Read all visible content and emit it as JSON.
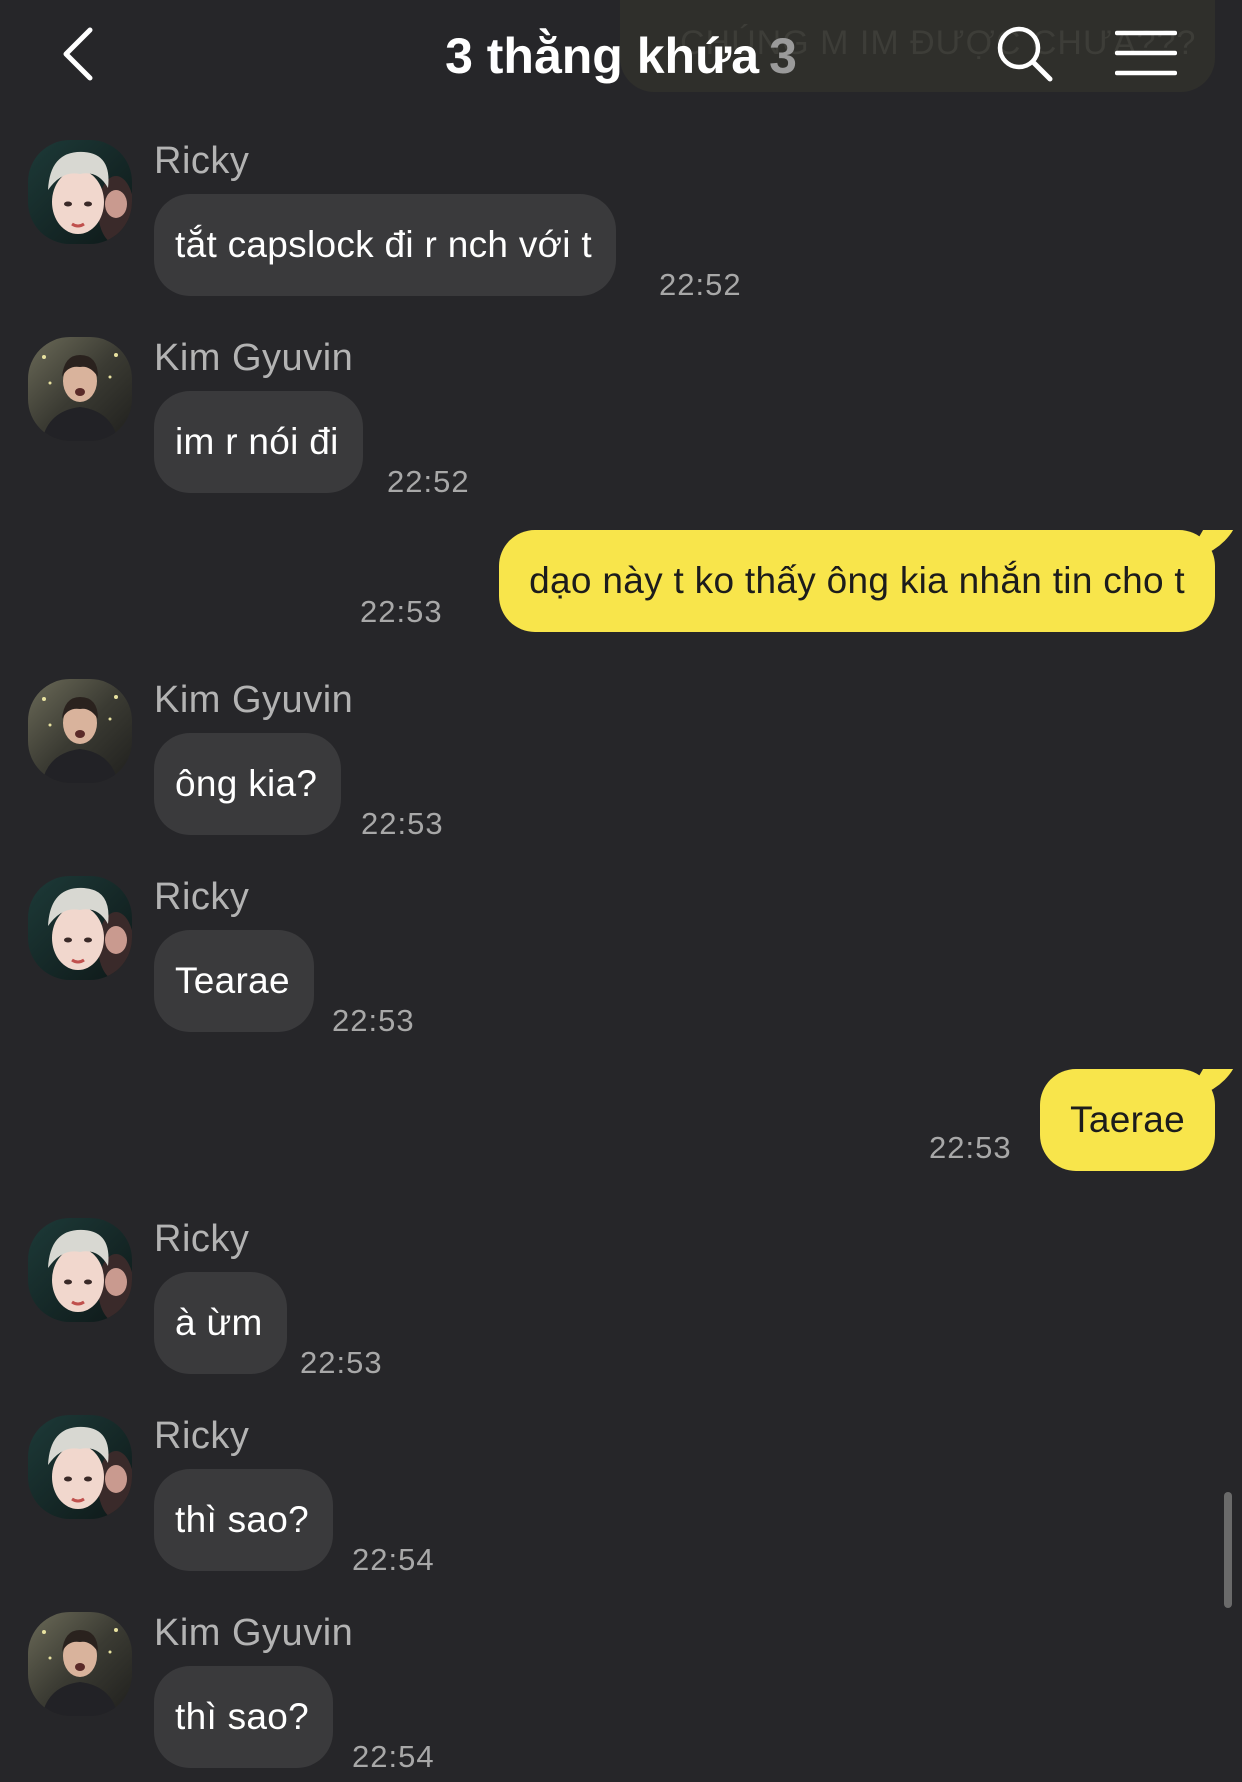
{
  "header": {
    "title": "3 thằng khứa",
    "member_count": "3",
    "notice_text": "CHÚNG M IM ĐƯỢC CHƯA???",
    "back_icon": "chevron-left-icon",
    "search_icon": "search-icon",
    "menu_icon": "hamburger-menu-icon"
  },
  "colors": {
    "background": "#262629",
    "incoming_bubble": "#3a3a3c",
    "outgoing_bubble": "#f8e54b",
    "timestamp": "#a8a8a8"
  },
  "messages": [
    {
      "direction": "in",
      "sender": "Ricky",
      "text": "tắt capslock đi r nch với t",
      "time": "22:52"
    },
    {
      "direction": "in",
      "sender": "Kim Gyuvin",
      "text": "im r nói đi",
      "time": "22:52"
    },
    {
      "direction": "out",
      "text": "dạo này t ko thấy ông kia nhắn tin cho t",
      "time": "22:53"
    },
    {
      "direction": "in",
      "sender": "Kim Gyuvin",
      "text": "ông kia?",
      "time": "22:53"
    },
    {
      "direction": "in",
      "sender": "Ricky",
      "text": "Tearae",
      "time": "22:53"
    },
    {
      "direction": "out",
      "text": "Taerae",
      "time": "22:53"
    },
    {
      "direction": "in",
      "sender": "Ricky",
      "text": "à ừm",
      "time": "22:53"
    },
    {
      "direction": "in",
      "sender": "Ricky",
      "text": "thì sao?",
      "time": "22:54"
    },
    {
      "direction": "in",
      "sender": "Kim Gyuvin",
      "text": "thì sao?",
      "time": "22:54"
    }
  ]
}
